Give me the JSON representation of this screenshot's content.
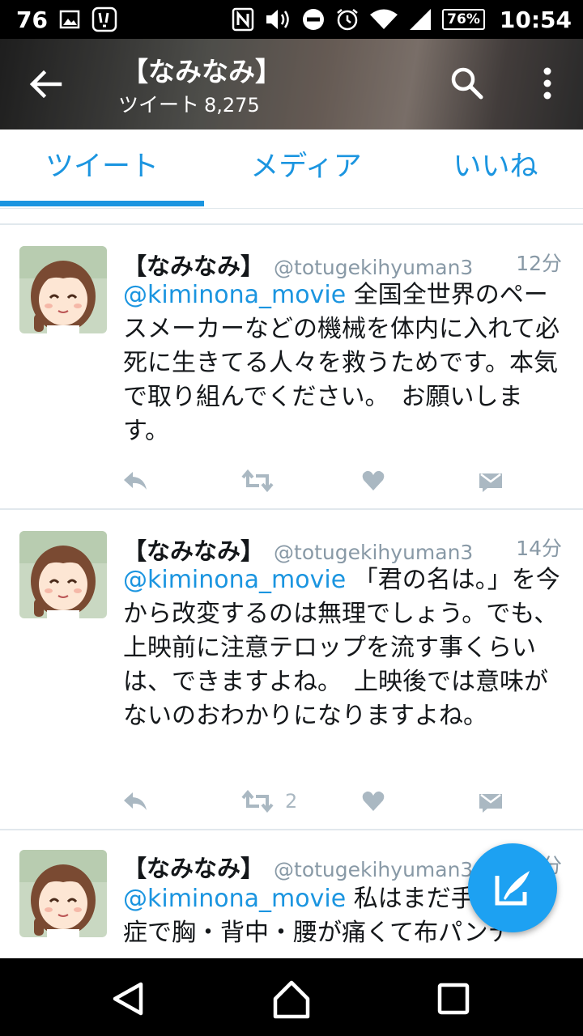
{
  "status_bar": {
    "notification_count": "76",
    "battery": "76%",
    "time": "10:54",
    "icons": [
      "image-icon",
      "app-notification-icon",
      "nfc-icon",
      "volume-icon",
      "do-not-disturb-icon",
      "alarm-icon",
      "wifi-icon",
      "signal-icon",
      "battery-icon"
    ]
  },
  "header": {
    "title": "【なみなみ】",
    "subtitle_label": "ツイート",
    "tweet_count": "8,275"
  },
  "tabs": [
    {
      "label": "ツイート",
      "active": true
    },
    {
      "label": "メディア",
      "active": false
    },
    {
      "label": "いいね",
      "active": false
    }
  ],
  "tweets": [
    {
      "name": "【なみなみ】",
      "handle": "@totugekihyuman3",
      "time": "12分",
      "mention": "@kiminona_movie",
      "text": " 全国全世界のペースメーカーなどの機械を体内に入れて必死に生きてる人々を救うためです。本気で取り組んでください。　お願いします。",
      "retweet_count": "",
      "like_count": ""
    },
    {
      "name": "【なみなみ】",
      "handle": "@totugekihyuman3",
      "time": "14分",
      "mention": "@kiminona_movie",
      "text": " 「君の名は。」を今から改変するのは無理でしょう。でも、上映前に注意テロップを流す事くらいは、できますよね。　上映後では意味がないのおわかりになりますよね。",
      "retweet_count": "2",
      "like_count": ""
    },
    {
      "name": "【なみなみ】",
      "handle": "@totugekihyuman3",
      "time": "分",
      "mention": "@kiminona_movie",
      "text": " 私はまだ手術後遺症で胸・背中・腰が痛くて布パンテ",
      "retweet_count": "",
      "like_count": ""
    }
  ],
  "colors": {
    "accent": "#1b95e0",
    "fab": "#1da1f2",
    "muted": "#8899a6",
    "action_icon": "#aab8c2"
  },
  "fab": {
    "icon": "compose-tweet-icon"
  },
  "nav": {
    "icons": [
      "back-triangle-icon",
      "home-icon",
      "recents-icon"
    ]
  }
}
